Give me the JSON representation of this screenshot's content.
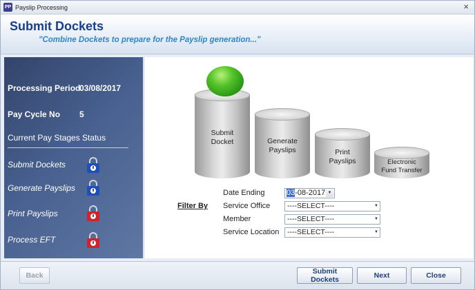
{
  "window": {
    "title": "Payslip Processing",
    "app_icon_text": "PP",
    "close_glyph": "×"
  },
  "header": {
    "title": "Submit Dockets",
    "subtitle": "\"Combine Dockets to prepare for the Payslip generation...\""
  },
  "left_panel": {
    "processing_period_label": "Processing Period",
    "processing_period_value": "03/08/2017",
    "pay_cycle_label": "Pay Cycle No",
    "pay_cycle_value": "5",
    "stages_heading": "Current Pay Stages Status",
    "stages": [
      {
        "label": "Submit Dockets",
        "lock_icon": "lock-icon",
        "lock_color": "#1f4fb8"
      },
      {
        "label": "Generate Payslips",
        "lock_icon": "lock-icon",
        "lock_color": "#1f4fb8"
      },
      {
        "label": "Print Payslips",
        "lock_icon": "lock-icon",
        "lock_color": "#d2232b"
      },
      {
        "label": "Process EFT",
        "lock_icon": "lock-icon",
        "lock_color": "#d2232b"
      }
    ]
  },
  "steps": {
    "current_indicator_icon": "green-ball-icon",
    "items": [
      {
        "line1": "Submit",
        "line2": "Docket"
      },
      {
        "line1": "Generate",
        "line2": "Payslips"
      },
      {
        "line1": "Print",
        "line2": "Payslips"
      },
      {
        "line1": "Electronic",
        "line2": "Fund Transfer"
      }
    ]
  },
  "filter": {
    "heading": "Filter By",
    "date_ending_label": "Date Ending",
    "date_ending_value_selected": "03",
    "date_ending_value_rest": "-08-2017",
    "service_office_label": "Service Office",
    "service_office_value": "----SELECT----",
    "member_label": "Member",
    "member_value": "----SELECT----",
    "service_location_label": "Service Location",
    "service_location_value": "----SELECT----",
    "dropdown_glyph": "▼"
  },
  "footer": {
    "back_label": "Back",
    "submit_label": "Submit Dockets",
    "next_label": "Next",
    "close_label": "Close"
  }
}
